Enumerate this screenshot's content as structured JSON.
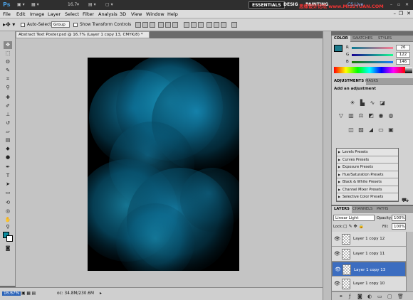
{
  "app": {
    "logo": "Ps",
    "zoom": "16.7"
  },
  "workspace": {
    "essentials": "ESSENTIALS",
    "design": "DESIG",
    "painting": "PAINTING",
    "cslive": "CS Live"
  },
  "watermark": "思缘设计论坛 www.MISSYUAN.COM",
  "menu": [
    "File",
    "Edit",
    "Image",
    "Layer",
    "Select",
    "Filter",
    "Analysis",
    "3D",
    "View",
    "Window",
    "Help"
  ],
  "options": {
    "auto_select": "Auto-Select:",
    "auto_select_value": "Group",
    "transform": "Show Transform Controls"
  },
  "document": {
    "tab": "Abstract Text Poster.psd @ 16.7% (Layer 1 copy 13, CMYK/8) *"
  },
  "status": {
    "zoom": "16.67%",
    "doc": "oc: 34.8M/230.6M"
  },
  "color_panel": {
    "tabs": [
      "COLOR",
      "SWATCHES",
      "STYLES"
    ],
    "r": {
      "label": "R",
      "value": "26"
    },
    "g": {
      "label": "G",
      "value": "122"
    },
    "b": {
      "label": "B",
      "value": "146"
    },
    "fg": "#1a7a92"
  },
  "adjust_panel": {
    "tabs": [
      "ADJUSTMENTS",
      "MASKS"
    ],
    "heading": "Add an adjustment",
    "presets": [
      "Levels Presets",
      "Curves Presets",
      "Exposure Presets",
      "Hue/Saturation Presets",
      "Black & White Presets",
      "Channel Mixer Presets",
      "Selective Color Presets"
    ]
  },
  "layers_panel": {
    "tabs": [
      "LAYERS",
      "CHANNELS",
      "PATHS"
    ],
    "blend": "Linear Light",
    "opacity_label": "Opacity:",
    "opacity": "100%",
    "lock_label": "Lock:",
    "fill_label": "Fill:",
    "fill": "100%",
    "layers": [
      {
        "name": "Layer 1 copy 12",
        "selected": false
      },
      {
        "name": "Layer 1 copy 11",
        "selected": false
      },
      {
        "name": "Layer 1 copy 13",
        "selected": true
      },
      {
        "name": "Layer 1 copy 10",
        "selected": false
      }
    ]
  }
}
